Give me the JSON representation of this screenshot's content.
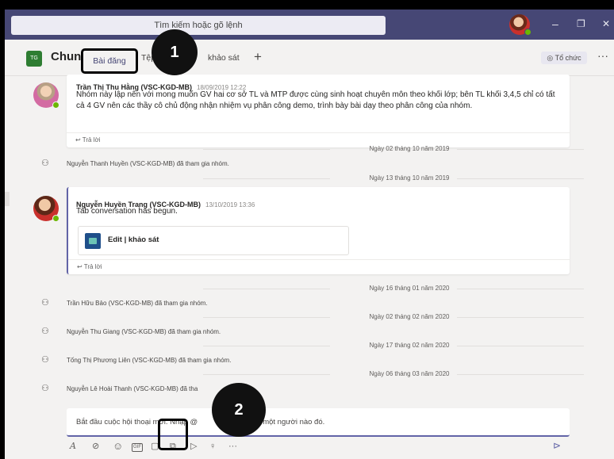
{
  "titlebar": {
    "search_placeholder": "Tìm kiếm hoặc gõ lệnh",
    "controls": {
      "minimize": "–",
      "maximize": "❐",
      "close": "✕"
    }
  },
  "header": {
    "team_badge": "TG",
    "channel_name": "Chung",
    "tabs": [
      {
        "label": "Bài đăng",
        "active": true
      },
      {
        "label": "Tệp",
        "active": false
      },
      {
        "label": "khảo sát",
        "active": false
      }
    ],
    "add_tab": "+",
    "org_button": "◎ Tổ chức",
    "more": "···"
  },
  "markers": {
    "first": "1",
    "second": "2"
  },
  "messages": [
    {
      "author": "Trần Thị Thu Hằng (VSC-KGD-MB)",
      "time": "18/09/2019 12:22",
      "text": "Nhóm này lập nên với mong muốn GV hai cơ sở TL và MTP được cùng sinh hoạt chuyên môn theo khối lớp; bên TL khối 3,4,5 chỉ có tất cả 4 GV nên các thầy cô chủ động nhận nhiệm vụ phân công demo, trình bày bài dạy theo phân công của nhóm.",
      "reply": "↩ Trả lời"
    },
    {
      "author": "Nguyễn Huyền Trang (VSC-KGD-MB)",
      "time": "13/10/2019 13:36",
      "text": "Tab conversation has begun.",
      "attachment": "Edit | khảo sát",
      "reply": "↩ Trả lời"
    }
  ],
  "dates": [
    "Ngày 02 tháng 10 năm 2019",
    "Ngày 13 tháng 10 năm 2019",
    "Ngày 16 tháng 01 năm 2020",
    "Ngày 02 tháng 02 năm 2020",
    "Ngày 17 tháng 02 năm 2020",
    "Ngày 06 tháng 03 năm 2020"
  ],
  "system_events": [
    "Nguyễn Thanh Huyền (VSC-KGD-MB) đã tham gia nhóm.",
    "Trần Hữu Bảo (VSC-KGD-MB) đã tham gia nhóm.",
    "Nguyễn Thu Giang (VSC-KGD-MB) đã tham gia nhóm.",
    "Tống Thị Phương Liên (VSC-KGD-MB) đã tham gia nhóm.",
    "Nguyễn Lê Hoài Thanh (VSC-KGD-MB) đã tha"
  ],
  "compose": {
    "placeholder_start": "Bắt đầu cuộc hội thoại mới. Nhập @",
    "placeholder_end": "một người nào đó."
  },
  "toolbar_icons": {
    "format": "A",
    "attach": "⊘",
    "emoji": "☺",
    "gif": "GIF",
    "sticker": "▢",
    "meet": "⧉",
    "stream": "▷",
    "praise": "♀",
    "more": "···",
    "send": "⊳"
  }
}
